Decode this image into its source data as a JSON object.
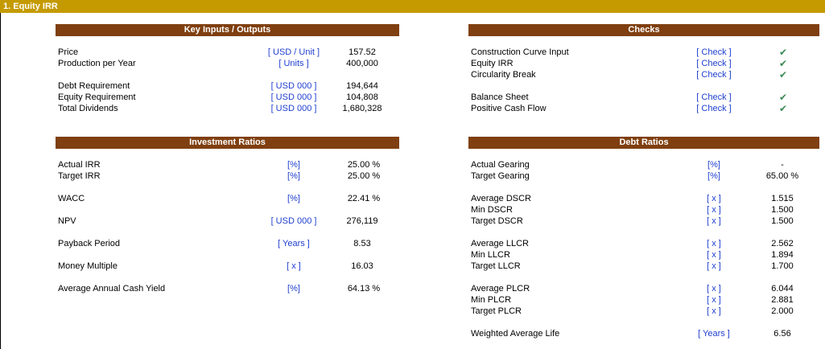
{
  "section_title": "1.  Equity IRR",
  "key_inputs": {
    "header": "Key Inputs / Outputs",
    "rows": [
      {
        "label": "Price",
        "unit": "[ USD / Unit ]",
        "value": "157.52"
      },
      {
        "label": "Production per Year",
        "unit": "[ Units ]",
        "value": "400,000"
      },
      {
        "label": "Debt Requirement",
        "unit": "[ USD 000 ]",
        "value": "194,644"
      },
      {
        "label": "Equity Requirement",
        "unit": "[ USD 000 ]",
        "value": "104,808"
      },
      {
        "label": "Total Dividends",
        "unit": "[ USD 000 ]",
        "value": "1,680,328"
      }
    ]
  },
  "checks": {
    "header": "Checks",
    "rows": [
      {
        "label": "Construction Curve Input",
        "unit": "[ Check ]",
        "icon": "check-icon"
      },
      {
        "label": "Equity IRR",
        "unit": "[ Check ]",
        "icon": "check-icon"
      },
      {
        "label": "Circularity Break",
        "unit": "[ Check ]",
        "icon": "check-icon"
      },
      {
        "label": "Balance Sheet",
        "unit": "[ Check ]",
        "icon": "check-icon"
      },
      {
        "label": "Positive Cash Flow",
        "unit": "[ Check ]",
        "icon": "check-icon"
      }
    ]
  },
  "investment_ratios": {
    "header": "Investment Ratios",
    "rows": [
      {
        "label": "Actual IRR",
        "unit": "[%]",
        "value": "25.00 %"
      },
      {
        "label": "Target IRR",
        "unit": "[%]",
        "value": "25.00 %"
      },
      {
        "label": "WACC",
        "unit": "[%]",
        "value": "22.41 %"
      },
      {
        "label": "NPV",
        "unit": "[ USD 000 ]",
        "value": "276,119"
      },
      {
        "label": "Payback Period",
        "unit": "[ Years ]",
        "value": "8.53"
      },
      {
        "label": "Money Multiple",
        "unit": "[ x ]",
        "value": "16.03"
      },
      {
        "label": "Average Annual Cash Yield",
        "unit": "[%]",
        "value": "64.13 %"
      }
    ]
  },
  "debt_ratios": {
    "header": "Debt Ratios",
    "rows": [
      {
        "label": "Actual Gearing",
        "unit": "[%]",
        "value": "-"
      },
      {
        "label": "Target Gearing",
        "unit": "[%]",
        "value": "65.00 %"
      },
      {
        "label": "Average DSCR",
        "unit": "[ x ]",
        "value": "1.515"
      },
      {
        "label": "Min DSCR",
        "unit": "[ x ]",
        "value": "1.500"
      },
      {
        "label": "Target DSCR",
        "unit": "[ x ]",
        "value": "1.500"
      },
      {
        "label": "Average LLCR",
        "unit": "[ x ]",
        "value": "2.562"
      },
      {
        "label": "Min LLCR",
        "unit": "[ x ]",
        "value": "1.894"
      },
      {
        "label": "Target LLCR",
        "unit": "[ x ]",
        "value": "1.700"
      },
      {
        "label": "Average PLCR",
        "unit": "[ x ]",
        "value": "6.044"
      },
      {
        "label": "Min PLCR",
        "unit": "[ x ]",
        "value": "2.881"
      },
      {
        "label": "Target PLCR",
        "unit": "[ x ]",
        "value": "2.000"
      },
      {
        "label": "Weighted Average Life",
        "unit": "[ Years ]",
        "value": "6.56"
      }
    ]
  }
}
